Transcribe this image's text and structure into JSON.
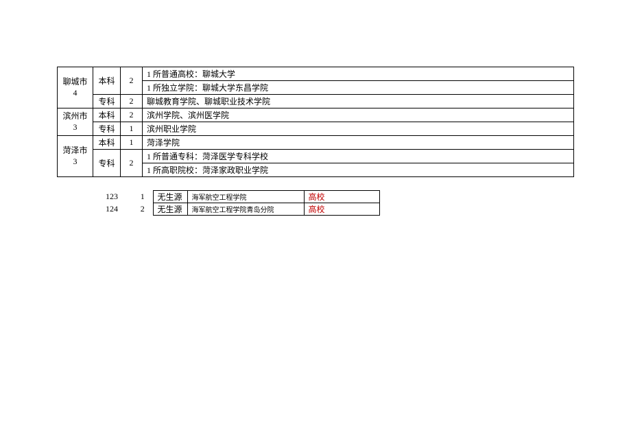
{
  "cities": [
    {
      "name": "聊城市",
      "count": "4",
      "rows": [
        {
          "level": "本科",
          "num": "2",
          "descs": [
            "1 所普通高校：聊城大学",
            "1 所独立学院：聊城大学东昌学院"
          ]
        },
        {
          "level": "专科",
          "num": "2",
          "descs": [
            "聊城教育学院、聊城职业技术学院"
          ]
        }
      ]
    },
    {
      "name": "滨州市",
      "count": "3",
      "rows": [
        {
          "level": "本科",
          "num": "2",
          "descs": [
            "滨州学院、滨州医学院"
          ]
        },
        {
          "level": "专科",
          "num": "1",
          "descs": [
            "滨州职业学院"
          ]
        }
      ]
    },
    {
      "name": "菏泽市",
      "count": "3",
      "rows": [
        {
          "level": "本科",
          "num": "1",
          "descs": [
            "菏泽学院"
          ]
        },
        {
          "level": "专科",
          "num": "2",
          "descs": [
            "1 所普通专科：菏泽医学专科学校",
            "1 所高职院校：菏泽家政职业学院"
          ]
        }
      ]
    }
  ],
  "extra": [
    {
      "idx": "123",
      "seq": "1",
      "nosource": "无生源",
      "school": "海军航空工程学院",
      "tag": "高校"
    },
    {
      "idx": "124",
      "seq": "2",
      "nosource": "无生源",
      "school": "海军航空工程学院青岛分院",
      "tag": "高校"
    }
  ]
}
